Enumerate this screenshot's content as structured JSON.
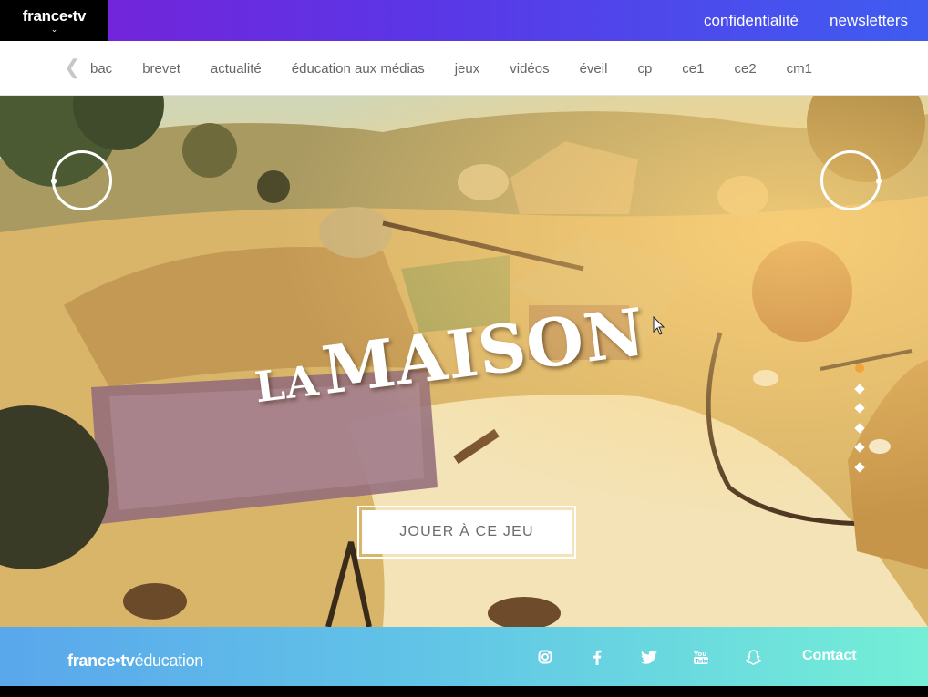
{
  "header": {
    "logo": "france•tv",
    "links": [
      "confidentialité",
      "newsletters"
    ]
  },
  "categories": [
    "bac",
    "brevet",
    "actualité",
    "éducation aux médias",
    "jeux",
    "vidéos",
    "éveil",
    "cp",
    "ce1",
    "ce2",
    "cm1"
  ],
  "hero": {
    "title_small": "LA",
    "title_large": "MAISON",
    "play_button": "JOUER À CE JEU",
    "slide_count": 6,
    "active_slide": 1,
    "accent_color": "#f0a33a"
  },
  "footer": {
    "logo_bold": "france•tv",
    "logo_light": "éducation",
    "socials": [
      "instagram-icon",
      "facebook-icon",
      "twitter-icon",
      "youtube-icon",
      "snapchat-icon"
    ],
    "contact": "Contact"
  },
  "colors": {
    "top_gradient_start": "#7a1fd6",
    "top_gradient_end": "#3f5cf0",
    "footer_gradient_start": "#5aa7ec",
    "footer_gradient_end": "#74efd6"
  }
}
